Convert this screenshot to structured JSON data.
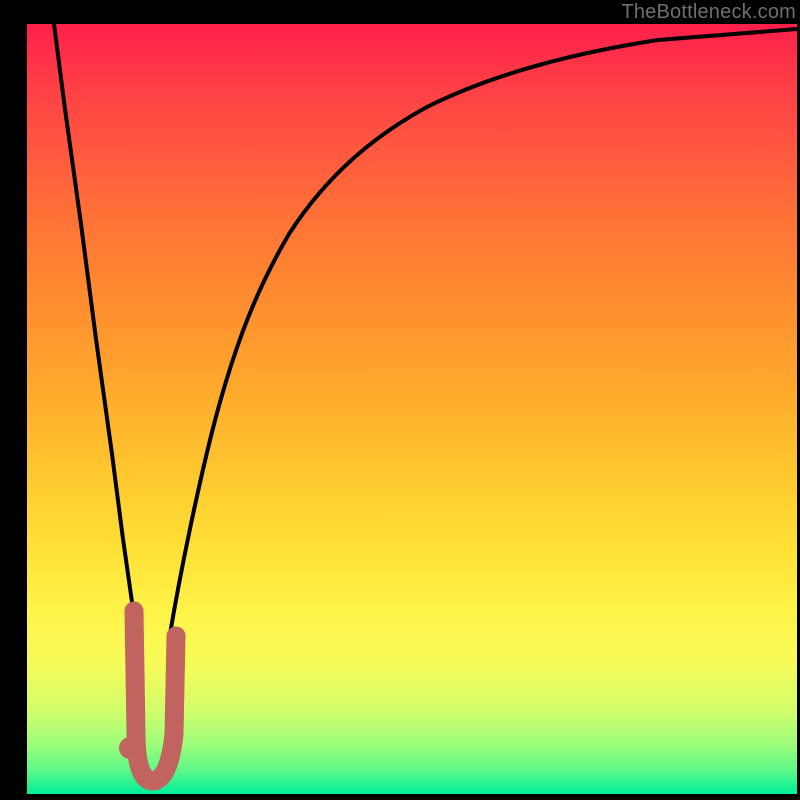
{
  "watermark": "TheBottleneck.com",
  "colors": {
    "frame": "#000000",
    "curve_main": "#000000",
    "marker_stroke": "#c1635e",
    "marker_fill": "#c1635e",
    "gradient_top": "#ff1f4b",
    "gradient_bottom": "#00ef99"
  },
  "chart_data": {
    "type": "line",
    "title": "",
    "xlabel": "",
    "ylabel": "",
    "xlim": [
      0,
      100
    ],
    "ylim": [
      0,
      100
    ],
    "series": [
      {
        "name": "left-branch",
        "x": [
          3.5,
          5,
          7,
          9,
          11,
          12.5,
          13.7
        ],
        "values": [
          100,
          89,
          74,
          59,
          44,
          33,
          24
        ]
      },
      {
        "name": "right-branch",
        "x": [
          18.5,
          20,
          22,
          24,
          27,
          30,
          34,
          39,
          45,
          52,
          60,
          70,
          82,
          100
        ],
        "values": [
          21,
          29,
          39,
          47,
          56,
          63,
          70,
          76,
          81,
          85,
          88.5,
          91.5,
          94,
          96.7
        ]
      }
    ],
    "marker": {
      "name": "j-mark",
      "x_range": [
        13.2,
        19.3
      ],
      "y_range": [
        1.5,
        24
      ],
      "shape": "J"
    }
  }
}
